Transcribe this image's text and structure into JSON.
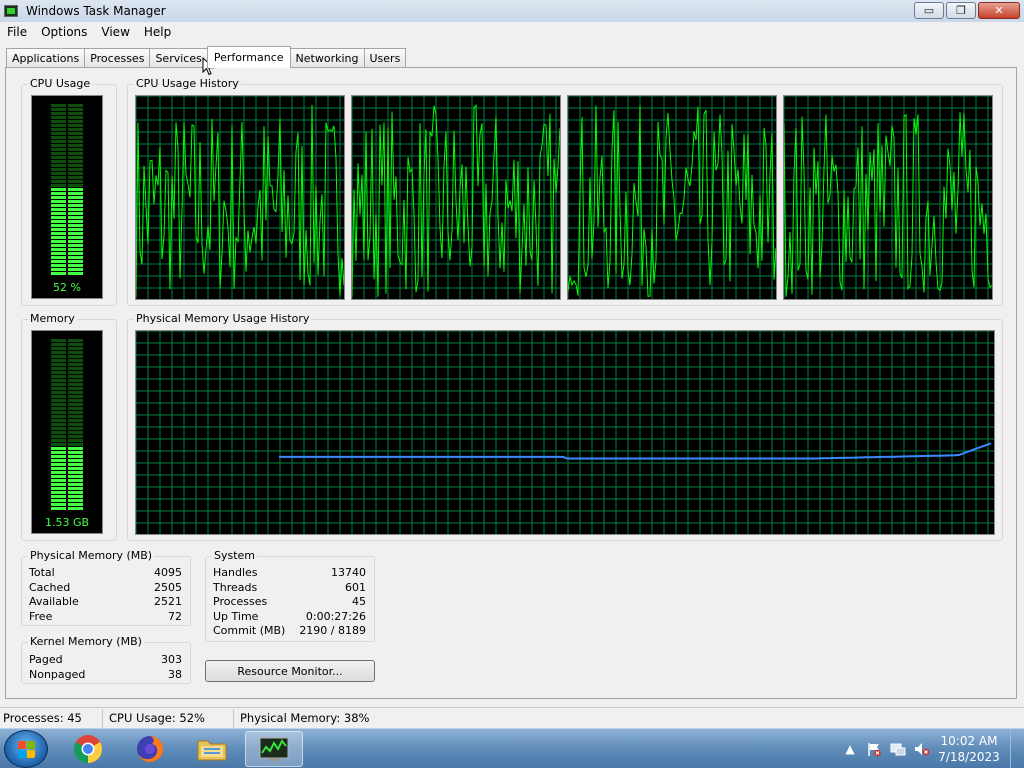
{
  "window": {
    "title": "Windows Task Manager",
    "controls": {
      "minimize": "▭",
      "maximize": "❐",
      "close": "✕"
    }
  },
  "menu": [
    "File",
    "Options",
    "View",
    "Help"
  ],
  "tabs": [
    {
      "label": "Applications",
      "active": false
    },
    {
      "label": "Processes",
      "active": false
    },
    {
      "label": "Services",
      "active": false
    },
    {
      "label": "Performance",
      "active": true
    },
    {
      "label": "Networking",
      "active": false
    },
    {
      "label": "Users",
      "active": false
    }
  ],
  "performance": {
    "cpu_usage": {
      "title": "CPU Usage",
      "value_label": "52 %",
      "level": 0.52
    },
    "cpu_history": {
      "title": "CPU Usage History",
      "cores": 4
    },
    "memory": {
      "title": "Memory",
      "value_label": "1.53 GB",
      "level": 0.38
    },
    "memory_history": {
      "title": "Physical Memory Usage History"
    },
    "physical_memory": {
      "title": "Physical Memory (MB)",
      "rows": [
        {
          "label": "Total",
          "value": "4095"
        },
        {
          "label": "Cached",
          "value": "2505"
        },
        {
          "label": "Available",
          "value": "2521"
        },
        {
          "label": "Free",
          "value": "72"
        }
      ]
    },
    "kernel_memory": {
      "title": "Kernel Memory (MB)",
      "rows": [
        {
          "label": "Paged",
          "value": "303"
        },
        {
          "label": "Nonpaged",
          "value": "38"
        }
      ]
    },
    "system": {
      "title": "System",
      "rows": [
        {
          "label": "Handles",
          "value": "13740"
        },
        {
          "label": "Threads",
          "value": "601"
        },
        {
          "label": "Processes",
          "value": "45"
        },
        {
          "label": "Up Time",
          "value": "0:00:27:26"
        },
        {
          "label": "Commit (MB)",
          "value": "2190 / 8189"
        }
      ]
    },
    "resource_monitor_button": "Resource Monitor..."
  },
  "statusbar": {
    "processes": "Processes: 45",
    "cpu": "CPU Usage: 52%",
    "memory": "Physical Memory: 38%"
  },
  "taskbar": {
    "apps": [
      {
        "name": "chrome-icon",
        "active": false
      },
      {
        "name": "firefox-icon",
        "active": false
      },
      {
        "name": "file-explorer-icon",
        "active": false
      },
      {
        "name": "task-manager-icon",
        "active": true
      }
    ],
    "clock": {
      "time": "10:02 AM",
      "date": "7/18/2023"
    }
  },
  "colors": {
    "graph_bg": "#000000",
    "grid": "#008040",
    "cpu_line": "#00ff00",
    "mem_line": "#3a8aff",
    "gauge_on": "#41ff41",
    "gauge_off": "#0b4f0b"
  }
}
